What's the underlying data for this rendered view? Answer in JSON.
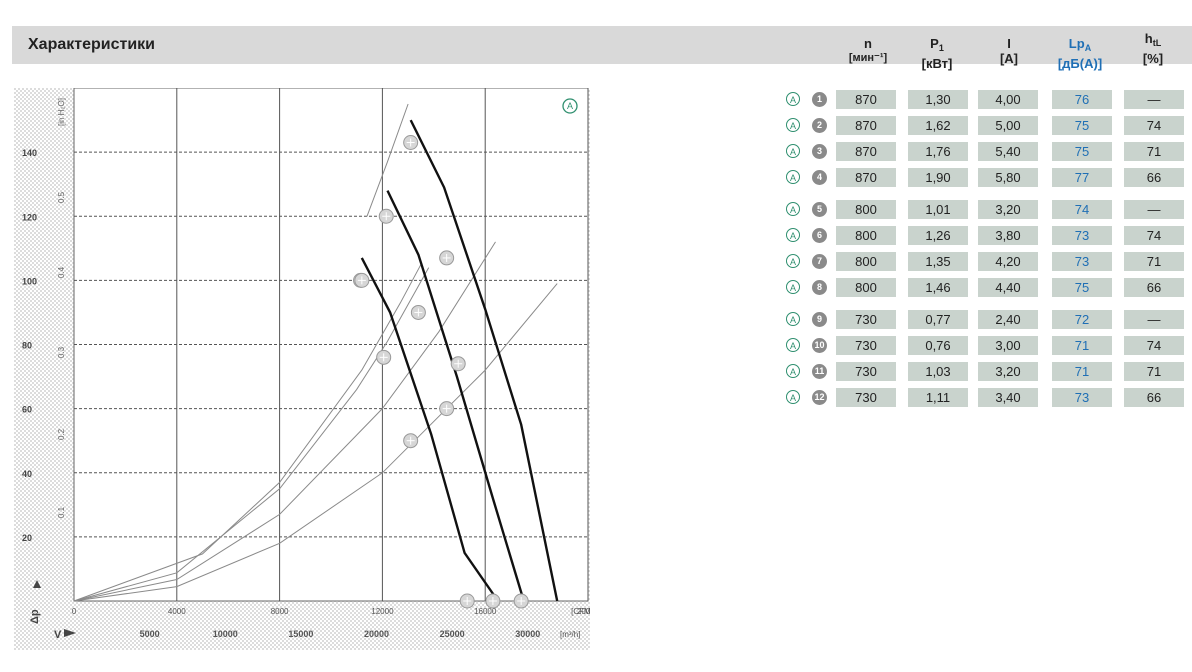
{
  "header": {
    "title": "Характеристики"
  },
  "columns": [
    {
      "name": "n",
      "unit": "[мин⁻¹]",
      "blue": false
    },
    {
      "name": "P",
      "sub": "1",
      "unit": "[кВт]",
      "blue": false
    },
    {
      "name": "I",
      "unit": "[A]",
      "blue": false
    },
    {
      "name": "Lp",
      "sub": "A",
      "unit": "[дБ(A)]",
      "blue": true
    },
    {
      "name": "h",
      "sub": "tL",
      "unit": "[%]",
      "blue": false
    }
  ],
  "rows": [
    {
      "no": "1",
      "n": "870",
      "p1": "1,30",
      "i": "4,00",
      "lpa": "76",
      "htl": "—"
    },
    {
      "no": "2",
      "n": "870",
      "p1": "1,62",
      "i": "5,00",
      "lpa": "75",
      "htl": "74"
    },
    {
      "no": "3",
      "n": "870",
      "p1": "1,76",
      "i": "5,40",
      "lpa": "75",
      "htl": "71"
    },
    {
      "no": "4",
      "n": "870",
      "p1": "1,90",
      "i": "5,80",
      "lpa": "77",
      "htl": "66"
    },
    {
      "no": "5",
      "n": "800",
      "p1": "1,01",
      "i": "3,20",
      "lpa": "74",
      "htl": "—"
    },
    {
      "no": "6",
      "n": "800",
      "p1": "1,26",
      "i": "3,80",
      "lpa": "73",
      "htl": "74"
    },
    {
      "no": "7",
      "n": "800",
      "p1": "1,35",
      "i": "4,20",
      "lpa": "73",
      "htl": "71"
    },
    {
      "no": "8",
      "n": "800",
      "p1": "1,46",
      "i": "4,40",
      "lpa": "75",
      "htl": "66"
    },
    {
      "no": "9",
      "n": "730",
      "p1": "0,77",
      "i": "2,40",
      "lpa": "72",
      "htl": "—"
    },
    {
      "no": "10",
      "n": "730",
      "p1": "0,76",
      "i": "3,00",
      "lpa": "71",
      "htl": "74"
    },
    {
      "no": "11",
      "n": "730",
      "p1": "1,03",
      "i": "3,20",
      "lpa": "71",
      "htl": "71"
    },
    {
      "no": "12",
      "n": "730",
      "p1": "1,11",
      "i": "3,40",
      "lpa": "73",
      "htl": "66"
    }
  ],
  "chart_data": {
    "type": "line",
    "corner_marker": "A",
    "x_axis": {
      "ticks": [
        0,
        4000,
        8000,
        12000,
        16000,
        20000
      ],
      "tick_labels": [
        "0",
        "4000",
        "8000",
        "12000",
        "16000",
        "20000"
      ],
      "unit": "[CFM]",
      "range": [
        0,
        20000
      ]
    },
    "x_axis_secondary": {
      "ticks": [
        5000,
        10000,
        15000,
        20000,
        25000,
        30000
      ],
      "tick_labels": [
        "5000",
        "10000",
        "15000",
        "20000",
        "25000",
        "30000"
      ],
      "unit": "[m³/h]",
      "symbol": "V"
    },
    "y_axis": {
      "ticks": [
        20,
        40,
        60,
        80,
        100,
        120,
        140
      ],
      "tick_labels": [
        "20",
        "40",
        "60",
        "80",
        "100",
        "120",
        "140"
      ],
      "label": "Δp",
      "range": [
        0,
        160
      ]
    },
    "y_axis_secondary": {
      "tick_labels": [
        "0.1",
        "0.2",
        "0.3",
        "0.4",
        "0.5"
      ],
      "unit": "[in H₂O]"
    },
    "grid": true,
    "series": [
      {
        "values": [
          [
            11200,
            107
          ],
          [
            12300,
            90
          ],
          [
            13900,
            52
          ],
          [
            15200,
            15
          ],
          [
            16500,
            0
          ]
        ]
      },
      {
        "values": [
          [
            12200,
            128
          ],
          [
            13400,
            108
          ],
          [
            14900,
            70
          ],
          [
            16300,
            32
          ],
          [
            17500,
            0
          ]
        ]
      },
      {
        "values": [
          [
            13100,
            150
          ],
          [
            14400,
            129
          ],
          [
            16000,
            91
          ],
          [
            17400,
            55
          ],
          [
            18800,
            0
          ]
        ]
      }
    ],
    "system_curves": [
      {
        "values": [
          [
            0,
            0
          ],
          [
            4000,
            8.8
          ],
          [
            8000,
            35
          ],
          [
            11000,
            66
          ],
          [
            12200,
            81
          ],
          [
            13800,
            104
          ]
        ]
      },
      {
        "values": [
          [
            0,
            0
          ],
          [
            4000,
            6.7
          ],
          [
            8000,
            27
          ],
          [
            12000,
            60
          ],
          [
            14200,
            84
          ],
          [
            16400,
            112
          ]
        ]
      },
      {
        "values": [
          [
            0,
            0
          ],
          [
            4000,
            4.5
          ],
          [
            8000,
            18
          ],
          [
            12000,
            40
          ],
          [
            16000,
            72
          ],
          [
            18800,
            99
          ]
        ]
      },
      {
        "values": [
          [
            0,
            0
          ],
          [
            5000,
            14.7
          ],
          [
            8000,
            37
          ],
          [
            11200,
            72
          ],
          [
            12700,
            93
          ],
          [
            13500,
            105
          ]
        ]
      },
      {
        "values": [
          [
            11400,
            120
          ],
          [
            12200,
            137
          ],
          [
            13000,
            155
          ]
        ]
      }
    ],
    "points": [
      {
        "label": "1",
        "x": 12150,
        "y": 120
      },
      {
        "label": "2",
        "x": 13100,
        "y": 143
      },
      {
        "label": "3",
        "x": 14500,
        "y": 107
      },
      {
        "label": "4",
        "x": 11150,
        "y": 100
      },
      {
        "label": "5",
        "x": 11200,
        "y": 100
      },
      {
        "label": "6",
        "x": 12050,
        "y": 76
      },
      {
        "label": "7",
        "x": 13400,
        "y": 90
      },
      {
        "label": "8",
        "x": 14950,
        "y": 74
      },
      {
        "label": "9",
        "x": 13100,
        "y": 50
      },
      {
        "label": "10",
        "x": 14500,
        "y": 60
      },
      {
        "label": "11",
        "x": 15300,
        "y": 0
      },
      {
        "label": "12",
        "x": 16300,
        "y": 0
      },
      {
        "label": "13",
        "x": 17400,
        "y": 0
      }
    ]
  }
}
